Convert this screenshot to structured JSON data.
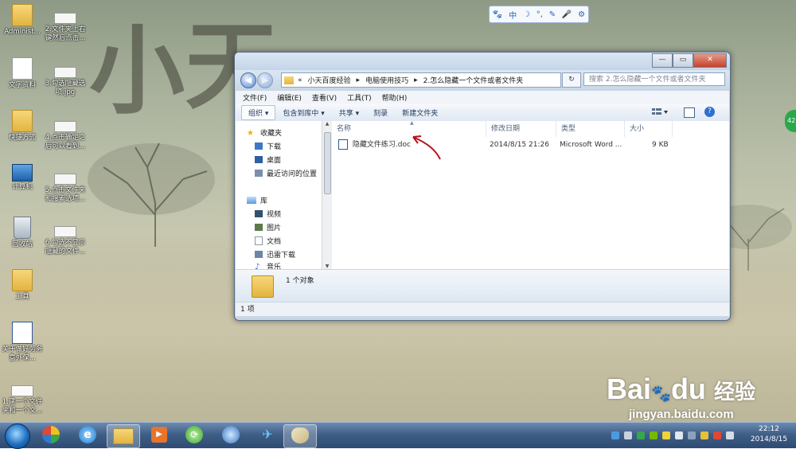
{
  "desktop": {
    "wallpaper_chars": [
      "小",
      "天"
    ],
    "icons": [
      {
        "label": "Administ...",
        "kind": "user-folder-icon"
      },
      {
        "label": "文字资料",
        "kind": "document-icon"
      },
      {
        "label": "快捷方式",
        "kind": "shortcut-icon"
      },
      {
        "label": "计算机",
        "kind": "computer-icon"
      },
      {
        "label": "回收站",
        "kind": "recycle-bin-icon"
      },
      {
        "label": "工具",
        "kind": "folder-icon"
      },
      {
        "label": "关于做好劳务意外保...",
        "kind": "word-document-icon"
      },
      {
        "label": "1.建一个文件夹和一个文...",
        "kind": "screenshot-icon"
      }
    ],
    "icons_col2": [
      {
        "label": "2.文件夹上右键然后点击..."
      },
      {
        "label": "3.勾选隐藏选项.jpg"
      },
      {
        "label": "4.点击确定之后可以看到..."
      },
      {
        "label": "5.点击文件夹和搜索选项..."
      },
      {
        "label": "6.勾选不显示隐藏的文件..."
      }
    ]
  },
  "ime_toolbar": {
    "items": [
      "🐾",
      "中",
      "☽",
      "°,",
      "✎",
      "🎤",
      "⚙"
    ]
  },
  "explorer": {
    "window_buttons": {
      "minimize": "—",
      "maximize": "▭",
      "close": "✕"
    },
    "nav": {
      "back": "◀",
      "forward": "▶"
    },
    "breadcrumb": [
      "«",
      "小天百度经验",
      "▸",
      "电脑使用技巧",
      "▸",
      "2.怎么隐藏一个文件或者文件夹"
    ],
    "refresh_glyph": "↻",
    "search_placeholder": "搜索 2.怎么隐藏一个文件或者文件夹",
    "menu": [
      "文件(F)",
      "编辑(E)",
      "查看(V)",
      "工具(T)",
      "帮助(H)"
    ],
    "commands": {
      "organize": "组织 ▾",
      "include": "包含到库中 ▾",
      "share": "共享 ▾",
      "burn": "刻录",
      "new_folder": "新建文件夹"
    },
    "nav_pane": {
      "favorites_header": "收藏夹",
      "favorites": [
        "下载",
        "桌面",
        "最近访问的位置"
      ],
      "libraries_header": "库",
      "libraries": [
        "视频",
        "图片",
        "文档",
        "迅雷下载",
        "音乐"
      ]
    },
    "columns": {
      "name": "名称",
      "modified": "修改日期",
      "type": "类型",
      "size": "大小"
    },
    "files": [
      {
        "name": "隐藏文件练习.doc",
        "modified": "2014/8/15 21:26",
        "type": "Microsoft Word ...",
        "size": "9 KB"
      }
    ],
    "details_text": "1 个对象",
    "status_text": "1 项"
  },
  "taskbar": {
    "clock_time": "22:12",
    "clock_date": "2014/8/15"
  },
  "side_badge": "42",
  "watermark": {
    "brand": "Bai",
    "brand_suffix": "du",
    "cn": "经验",
    "url": "jingyan.baidu.com"
  },
  "colors": {
    "accent": "#1a62c4",
    "annotation_arrow": "#b5121b",
    "taskbar": "#3f5f87"
  }
}
